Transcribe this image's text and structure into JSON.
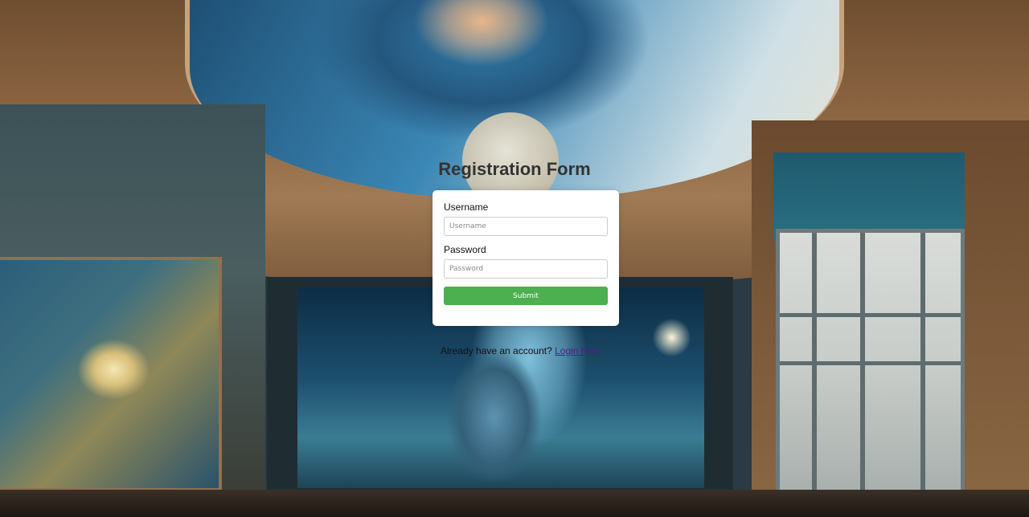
{
  "page": {
    "title": "Registration Form"
  },
  "form": {
    "username_label": "Username",
    "username_placeholder": "Username",
    "username_value": "",
    "password_label": "Password",
    "password_placeholder": "Password",
    "password_value": "",
    "submit_label": "Submit"
  },
  "footer": {
    "prompt_text": "Already have an account?",
    "login_link_text": "Login here"
  },
  "colors": {
    "submit_button": "#4caf50",
    "title_text": "#333333",
    "link_visited": "#551a8b"
  }
}
